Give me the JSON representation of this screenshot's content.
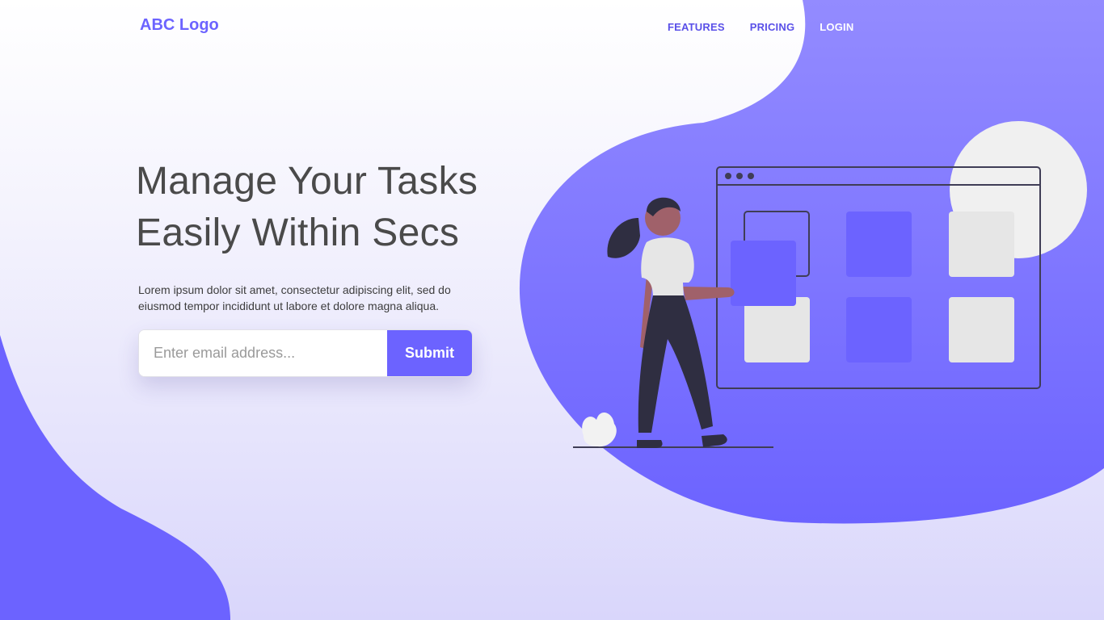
{
  "brand": {
    "logo_text": "ABC Logo"
  },
  "nav": {
    "items": [
      {
        "label": "FEATURES"
      },
      {
        "label": "PRICING"
      },
      {
        "label": "LOGIN"
      }
    ]
  },
  "hero": {
    "headline_line1": "Manage Your Tasks",
    "headline_line2": "Easily Within Secs",
    "description": "Lorem ipsum dolor sit amet, consectetur adipiscing elit, sed do eiusmod tempor incididunt ut labore et dolore magna aliqua.",
    "email_placeholder": "Enter email address...",
    "email_value": "",
    "submit_label": "Submit"
  },
  "illustration": {
    "name": "task-board-illustration",
    "icons": [
      "browser-window",
      "person",
      "plant"
    ]
  },
  "colors": {
    "accent": "#6c63ff",
    "heading": "#4a4a4a",
    "text": "#3d3d3d",
    "tile_gray": "#e6e6e6",
    "skin": "#a0616a",
    "pants": "#2f2e41"
  }
}
